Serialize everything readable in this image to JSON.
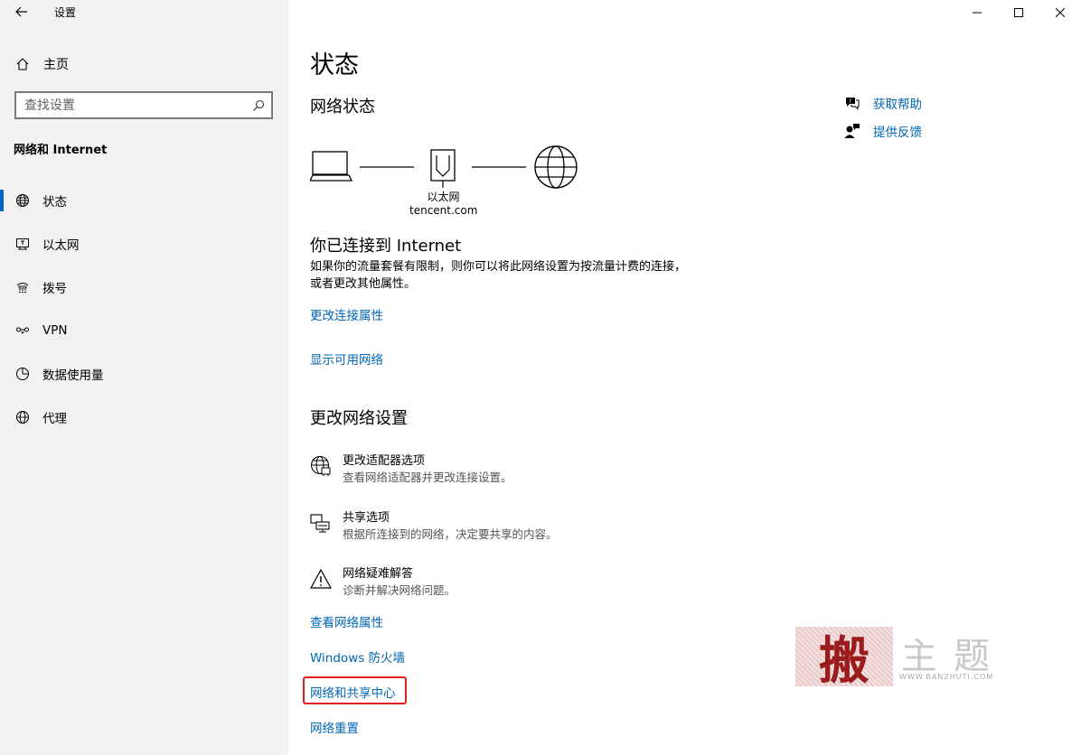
{
  "window": {
    "app_title": "设置"
  },
  "sidebar": {
    "home_label": "主页",
    "search_placeholder": "查找设置",
    "section_heading": "网络和 Internet",
    "items": [
      {
        "label": "状态",
        "icon": "status-globe-icon",
        "active": true
      },
      {
        "label": "以太网",
        "icon": "ethernet-icon",
        "active": false
      },
      {
        "label": "拨号",
        "icon": "dialup-icon",
        "active": false
      },
      {
        "label": "VPN",
        "icon": "vpn-icon",
        "active": false
      },
      {
        "label": "数据使用量",
        "icon": "data-usage-icon",
        "active": false
      },
      {
        "label": "代理",
        "icon": "proxy-globe-icon",
        "active": false
      }
    ]
  },
  "main": {
    "title": "状态",
    "network_status_title": "网络状态",
    "diagram": {
      "adapter_label": "以太网",
      "network_name": "tencent.com"
    },
    "connected_title": "你已连接到 Internet",
    "connected_desc": "如果你的流量套餐有限制，则你可以将此网络设置为按流量计费的连接，或者更改其他属性。",
    "link_change_props": "更改连接属性",
    "link_show_networks": "显示可用网络",
    "change_settings_title": "更改网络设置",
    "options": [
      {
        "title": "更改适配器选项",
        "desc": "查看网络适配器并更改连接设置。",
        "icon": "adapter-globe-icon"
      },
      {
        "title": "共享选项",
        "desc": "根据所连接到的网络，决定要共享的内容。",
        "icon": "sharing-icon"
      },
      {
        "title": "网络疑难解答",
        "desc": "诊断并解决网络问题。",
        "icon": "warning-icon"
      }
    ],
    "links": {
      "view_properties": "查看网络属性",
      "firewall": "Windows 防火墙",
      "sharing_center": "网络和共享中心",
      "reset": "网络重置"
    }
  },
  "help": {
    "get_help": "获取帮助",
    "feedback": "提供反馈"
  },
  "watermark": {
    "stamp_char": "搬",
    "text": "主题",
    "url": "WWW.BANZHUTI.COM"
  },
  "colors": {
    "link": "#0066b4",
    "accent": "#0067c0",
    "highlight_border": "#e02020",
    "sidebar_bg": "#f2f2f2"
  }
}
